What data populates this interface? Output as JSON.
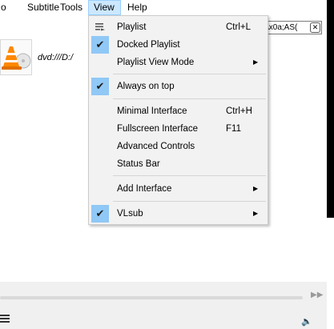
{
  "menubar": {
    "items": [
      {
        "label": "o"
      },
      {
        "label": "Subtitle"
      },
      {
        "label": "Tools"
      },
      {
        "label": "View"
      },
      {
        "label": "Help"
      }
    ]
  },
  "playlist": {
    "search_value": "\\x0a;AS(",
    "items": [
      {
        "label": "dvd:///D:/"
      }
    ]
  },
  "view_menu": {
    "items": [
      {
        "label": "Playlist",
        "shortcut": "Ctrl+L",
        "checked": false,
        "icon": "playlist-icon"
      },
      {
        "label": "Docked Playlist",
        "shortcut": "",
        "checked": true
      },
      {
        "label": "Playlist View Mode",
        "shortcut": "",
        "checked": false,
        "submenu": true
      },
      {
        "label": "Always on top",
        "shortcut": "",
        "checked": true
      },
      {
        "label": "Minimal Interface",
        "shortcut": "Ctrl+H",
        "checked": false
      },
      {
        "label": "Fullscreen Interface",
        "shortcut": "F11",
        "checked": false
      },
      {
        "label": "Advanced Controls",
        "shortcut": "",
        "checked": false
      },
      {
        "label": "Status Bar",
        "shortcut": "",
        "checked": false
      },
      {
        "label": "Add Interface",
        "shortcut": "",
        "checked": false,
        "submenu": true
      },
      {
        "label": "VLsub",
        "shortcut": "",
        "checked": true,
        "submenu": true
      }
    ]
  },
  "colors": {
    "menu_active": "#cce8ff",
    "check_highlight": "#90c8f6",
    "menu_bg": "#f2f2f2"
  }
}
